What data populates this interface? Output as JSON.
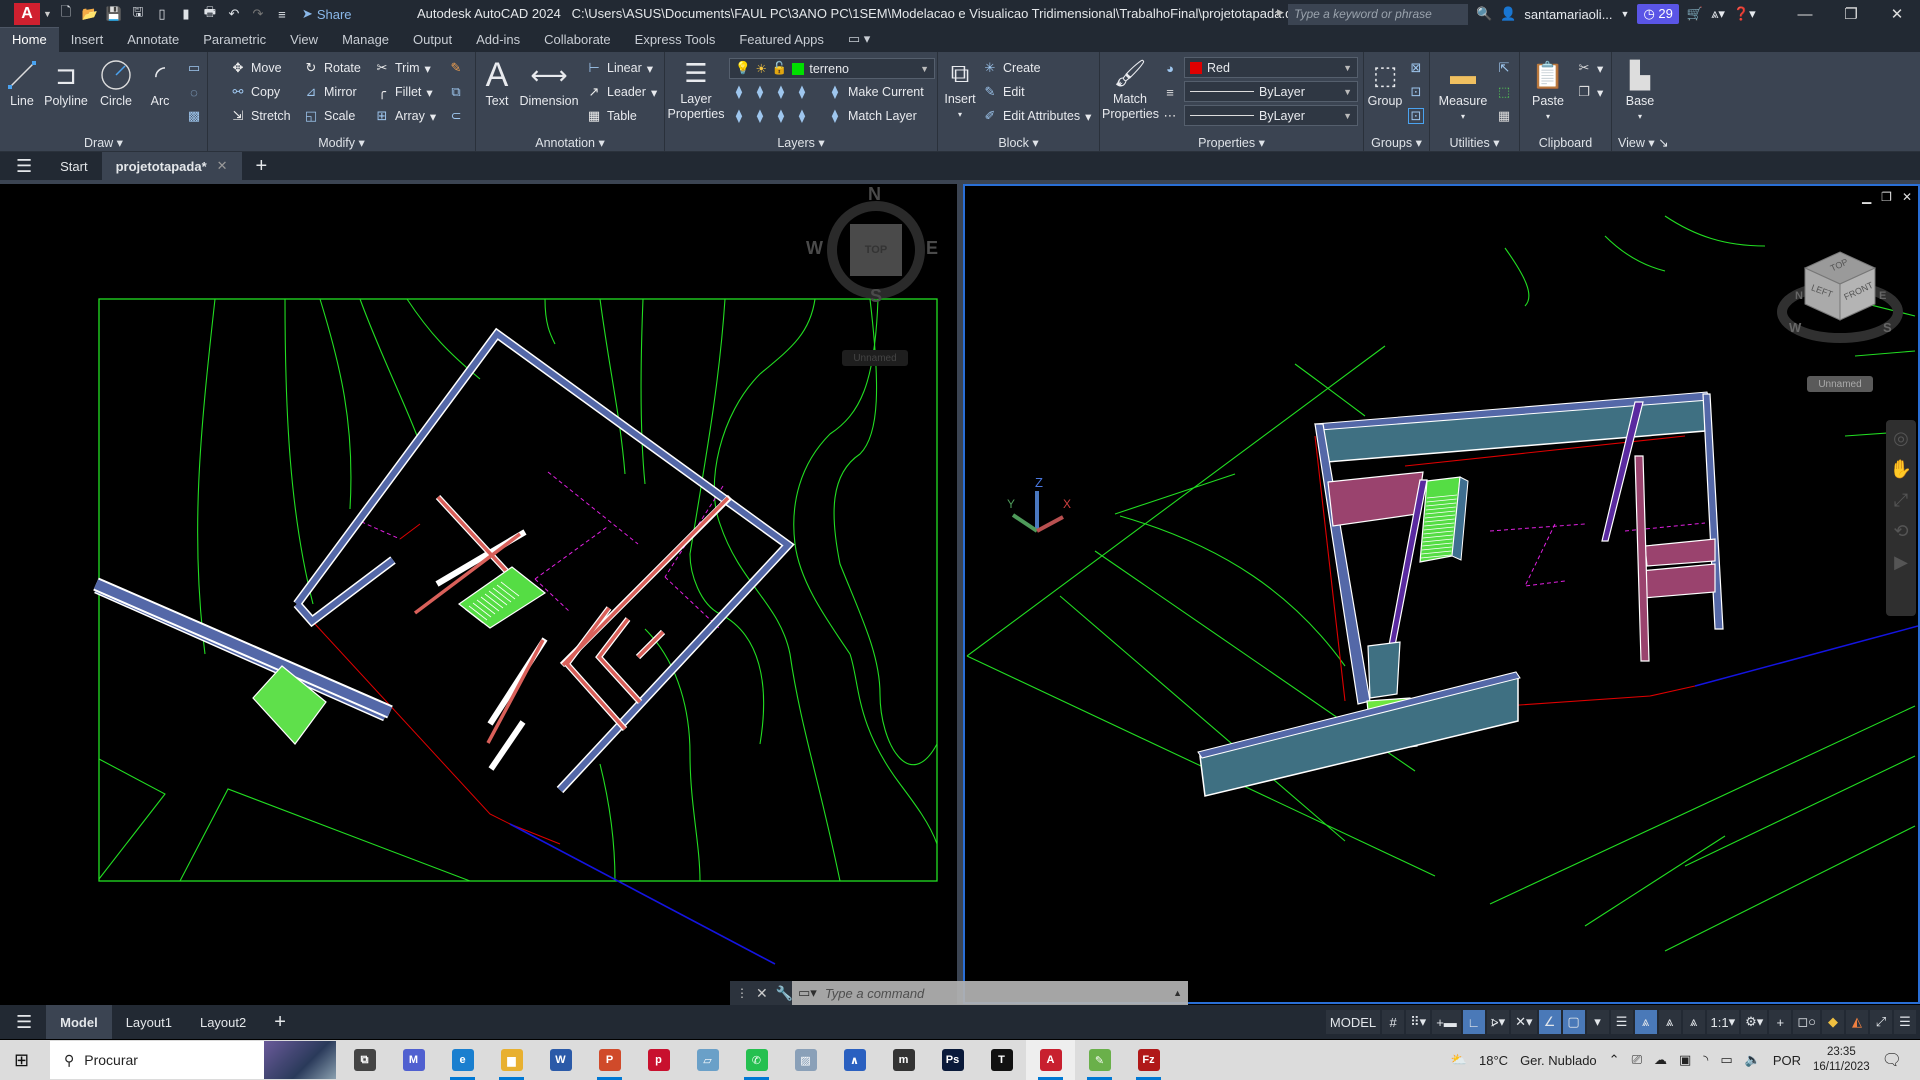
{
  "app": {
    "title": "Autodesk AutoCAD 2024",
    "file_path": "C:\\Users\\ASUS\\Documents\\FAUL PC\\3ANO PC\\1SEM\\Modelacao e Visualicao Tridimensional\\TrabalhoFinal\\projetotapada.dwg",
    "logo_letter": "A",
    "share_label": "Share",
    "search_placeholder": "Type a keyword or phrase",
    "user_name": "santamariaoli...",
    "trial_days": "29"
  },
  "ribbon_tabs": [
    "Home",
    "Insert",
    "Annotate",
    "Parametric",
    "View",
    "Manage",
    "Output",
    "Add-ins",
    "Collaborate",
    "Express Tools",
    "Featured Apps"
  ],
  "active_ribbon_tab": "Home",
  "ribbon": {
    "draw": {
      "title": "Draw",
      "line": "Line",
      "polyline": "Polyline",
      "circle": "Circle",
      "arc": "Arc"
    },
    "modify": {
      "title": "Modify",
      "move": "Move",
      "rotate": "Rotate",
      "trim": "Trim",
      "copy": "Copy",
      "mirror": "Mirror",
      "fillet": "Fillet",
      "stretch": "Stretch",
      "scale": "Scale",
      "array": "Array"
    },
    "annotation": {
      "title": "Annotation",
      "text": "Text",
      "dimension": "Dimension",
      "linear": "Linear",
      "leader": "Leader",
      "table": "Table"
    },
    "layers": {
      "title": "Layers",
      "layer_properties": "Layer Properties",
      "current_layer": "terreno",
      "current_layer_color": "#00e000",
      "make_current": "Make Current",
      "match_layer": "Match Layer"
    },
    "block": {
      "title": "Block",
      "insert": "Insert",
      "create": "Create",
      "edit": "Edit",
      "edit_attributes": "Edit Attributes"
    },
    "properties": {
      "title": "Properties",
      "match_properties": "Match Properties",
      "color": "Red",
      "color_hex": "#e00000",
      "linetype": "ByLayer",
      "lineweight": "ByLayer"
    },
    "groups": {
      "title": "Groups",
      "group": "Group"
    },
    "utilities": {
      "title": "Utilities",
      "measure": "Measure"
    },
    "clipboard": {
      "title": "Clipboard",
      "paste": "Paste"
    },
    "view": {
      "title": "View",
      "base": "Base"
    }
  },
  "file_tabs": {
    "start": "Start",
    "active": "projetotapada*"
  },
  "viewport_left": {
    "compass": {
      "n": "N",
      "s": "S",
      "e": "E",
      "w": "W",
      "face": "TOP"
    },
    "ucs_menu": "Unnamed"
  },
  "viewport_right": {
    "cube": {
      "top": "TOP",
      "left": "LEFT",
      "front": "FRONT",
      "n": "N",
      "e": "E",
      "s": "S",
      "w": "W"
    },
    "ucs_menu": "Unnamed",
    "ucs_axes": {
      "x": "X",
      "y": "Y",
      "z": "Z"
    }
  },
  "command_line": {
    "placeholder": "Type a command"
  },
  "layout_tabs": [
    "Model",
    "Layout1",
    "Layout2"
  ],
  "status_bar": {
    "space": "MODEL",
    "scale": "1:1"
  },
  "taskbar": {
    "search": "Procurar",
    "weather_temp": "18°C",
    "weather_desc": "Ger. Nublado",
    "language": "POR",
    "time": "23:35",
    "date": "16/11/2023"
  }
}
